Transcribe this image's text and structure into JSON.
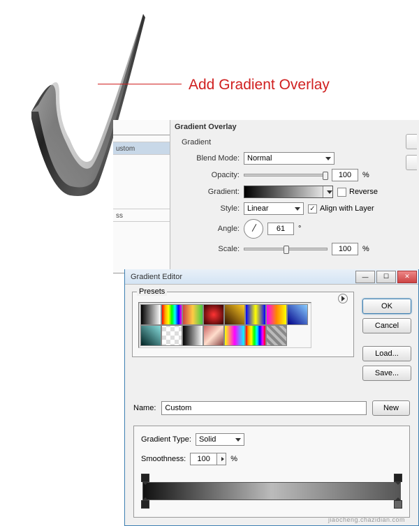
{
  "annotation": {
    "text": "Add Gradient Overlay"
  },
  "layerStyle": {
    "title": "Gradient Overlay",
    "sidebar": {
      "item1": "ustom",
      "item2": "ss"
    },
    "gradient": {
      "legend": "Gradient",
      "blendMode": {
        "label": "Blend Mode:",
        "value": "Normal"
      },
      "opacity": {
        "label": "Opacity:",
        "value": "100",
        "unit": "%"
      },
      "gradientLabel": "Gradient:",
      "reverse": {
        "label": "Reverse",
        "checked": false
      },
      "style": {
        "label": "Style:",
        "value": "Linear"
      },
      "alignWithLayer": {
        "label": "Align with Layer",
        "checked": true
      },
      "angle": {
        "label": "Angle:",
        "value": "61",
        "unit": "°"
      },
      "scale": {
        "label": "Scale:",
        "value": "100",
        "unit": "%"
      }
    }
  },
  "gradientEditor": {
    "title": "Gradient Editor",
    "buttons": {
      "ok": "OK",
      "cancel": "Cancel",
      "load": "Load...",
      "save": "Save..."
    },
    "presets": {
      "legend": "Presets",
      "items": [
        "linear-gradient(90deg,#000,#fff)",
        "linear-gradient(90deg,#f00,#fa0,#ff0,#0f0,#0ff,#00f,#f0f)",
        "linear-gradient(90deg,#c44,#fc4,#4c4)",
        "radial-gradient(#f33,#300)",
        "linear-gradient(45deg,#310,#fc2)",
        "linear-gradient(90deg,#00f,#ff0,#00f)",
        "linear-gradient(90deg,#f0f,#f80,#ff0)",
        "linear-gradient(45deg,#008,#8cf)",
        "linear-gradient(45deg,#022,#8dd)",
        "repeating-conic-gradient(#ddd 0 25%, #fff 0 50%) 0/12px 12px",
        "linear-gradient(90deg,#000,#fff)",
        "linear-gradient(135deg,#c66,#fdc,#844)",
        "linear-gradient(90deg,#ff0,#f0f,#0ff)",
        "linear-gradient(90deg,#f00,#fa0,#ff0,#0f0,#0ff,#00f,#f0f,#f00)",
        "repeating-linear-gradient(45deg,#bbb 0 4px,#888 4px 8px)"
      ]
    },
    "name": {
      "label": "Name:",
      "value": "Custom"
    },
    "new": "New",
    "gradientType": {
      "label": "Gradient Type:",
      "value": "Solid"
    },
    "smoothness": {
      "label": "Smoothness:",
      "value": "100",
      "unit": "%"
    }
  },
  "watermark": "jiaocheng.chazidian.com"
}
